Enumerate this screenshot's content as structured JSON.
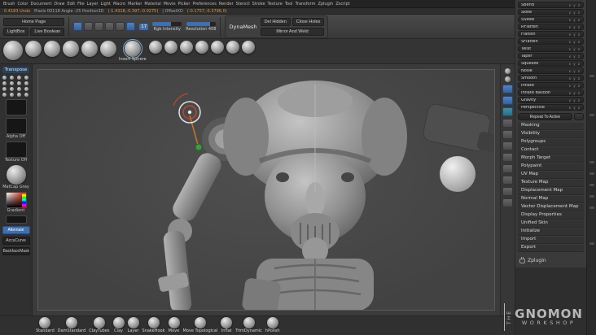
{
  "menubar": {
    "items": [
      "Brush",
      "Color",
      "Document",
      "Draw",
      "Edit",
      "File",
      "Layer",
      "Light",
      "Macro",
      "Marker",
      "Material",
      "Movie",
      "Picker",
      "Preferences",
      "Render",
      "Stencil",
      "Stroke",
      "Texture",
      "Tool",
      "Transform",
      "Zplugin",
      "Zscript"
    ]
  },
  "statusbar": {
    "segments": [
      {
        "text": "0.4183 Undo",
        "tone": "orange"
      },
      {
        "text": "Pixols 00118 Angle -25 Position3D",
        "tone": "gray"
      },
      {
        "text": "(-1.4318,-0.397,-0.0275)",
        "tone": "orange"
      },
      {
        "text": "| OffsetXD",
        "tone": "gray"
      },
      {
        "text": "(-0.1757,-0.3796,0)",
        "tone": "orange"
      }
    ]
  },
  "toolbar": {
    "home_page": "Home Page",
    "lightbox": "LightBox",
    "live_boolean": "Live Boolean",
    "draw_size_value": "17",
    "rgb_intensity_label": "Rgb Intensity",
    "resolution_label": "Resolution 408",
    "dynamesh_title": "DynaMesh",
    "dynamesh_buttons": [
      "Del Hidden",
      "Close Holes",
      "Mirror And Weld"
    ]
  },
  "brush_shelf": {
    "insert_sphere_label": "Insert Sphere"
  },
  "left_shelf": {
    "transpose_label": "Transpose",
    "alpha_label": "Alpha Off",
    "texture_label": "Texture Off",
    "material_label": "MatCap Gray",
    "gradient_label": "Gradient",
    "buttons": [
      "Alternate",
      "AccuCurve",
      "BackfaceMask"
    ]
  },
  "deformation": {
    "axes_label": "x y z",
    "sliders": [
      "SBend",
      "Skew",
      "SSkew",
      "RFlatten",
      "Flatten",
      "SFlatten",
      "Twist",
      "Taper",
      "Squeeze",
      "Noise",
      "Smooth",
      "Inflate",
      "Inflate Balloon",
      "Gravity",
      "Perspective"
    ],
    "repeat_button": "Repeat To Active"
  },
  "tool_sections": {
    "items": [
      "Masking",
      "Visibility",
      "Polygroups",
      "Contact",
      "Morph Target",
      "Polypaint",
      "UV Map",
      "Texture Map",
      "Displacement Map",
      "Normal Map",
      "Vector Displacement Map",
      "Display Properties",
      "Unified Skin",
      "Initialize",
      "Import",
      "Export"
    ],
    "zplugin_label": "Zplugin"
  },
  "bottom_brushes": {
    "items": [
      "Standard",
      "DamStandard",
      "ClayTubes",
      "Clay",
      "Layer",
      "SnakeHook",
      "Move",
      "Move Topological",
      "Inflat",
      "TrimDynamic",
      "hPolish"
    ]
  },
  "logo": {
    "the": "THE",
    "gnomon": "GNOMON",
    "workshop": "WORKSHOP"
  },
  "colors": {
    "accent_blue": "#3e6fae",
    "accent_orange": "#e2953f"
  }
}
